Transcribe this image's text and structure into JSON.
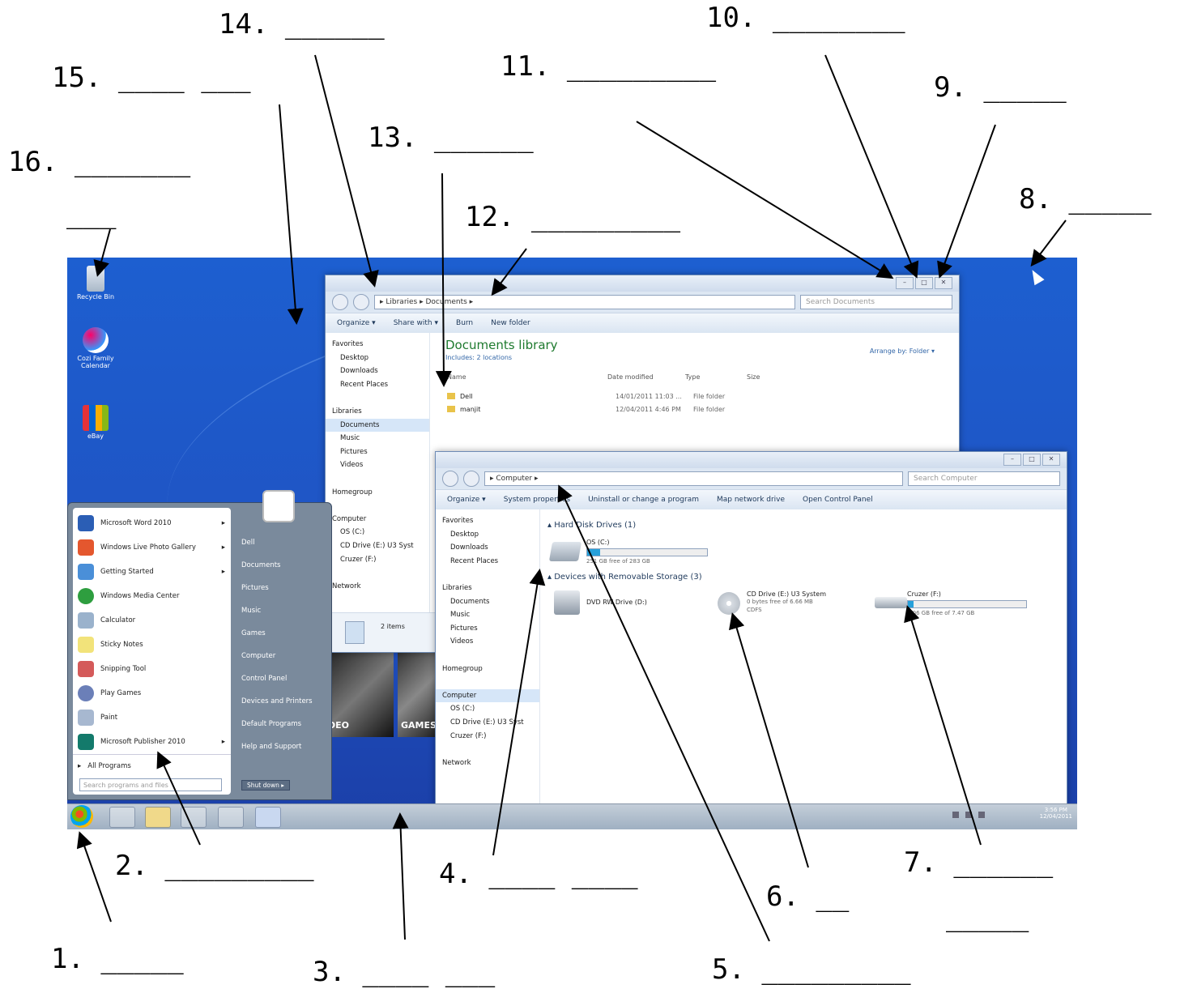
{
  "labels": {
    "l1": "1. _____",
    "l2": "2. _________",
    "l3": "3. ____ ___",
    "l4": "4. ____ ____",
    "l5": "5. _________",
    "l6": "6. __",
    "l7a": "7. ______",
    "l7b": "_____",
    "l8": "8. _____",
    "l9": "9. _____",
    "l10": "10. ________",
    "l11": "11. _________",
    "l12": "12. _________",
    "l13": "13. ______",
    "l14": "14. ______",
    "l15": "15. ____ ___",
    "l16a": "16. _______",
    "l16b": "___"
  },
  "desktop_icons": [
    "Recycle Bin",
    "Cozi Family Calendar",
    "eBay"
  ],
  "docs_window": {
    "address": "▸ Libraries ▸ Documents ▸",
    "search": "Search Documents",
    "toolbar": [
      "Organize ▾",
      "Share with ▾",
      "Burn",
      "New folder"
    ],
    "heading": "Documents library",
    "includes": "Includes: 2 locations",
    "arrange": "Arrange by:  Folder ▾",
    "columns": [
      "Name",
      "Date modified",
      "Type",
      "Size"
    ],
    "files": [
      {
        "name": "Dell",
        "date": "14/01/2011 11:03 ...",
        "type": "File folder"
      },
      {
        "name": "manjit",
        "date": "12/04/2011 4:46 PM",
        "type": "File folder"
      }
    ],
    "nav": [
      "Favorites",
      "Desktop",
      "Downloads",
      "Recent Places",
      "",
      "Libraries",
      "Documents",
      "Music",
      "Pictures",
      "Videos",
      "",
      "Homegroup",
      "",
      "Computer",
      "OS (C:)",
      "CD Drive (E:) U3 Syst",
      "Cruzer (F:)",
      "",
      "Network"
    ],
    "status": "2 items"
  },
  "comp_window": {
    "address": "▸ Computer ▸",
    "search": "Search Computer",
    "toolbar": [
      "Organize ▾",
      "System properties",
      "Uninstall or change a program",
      "Map network drive",
      "Open Control Panel"
    ],
    "hdd_heading": "▴ Hard Disk Drives (1)",
    "removable_heading": "▴ Devices with Removable Storage (3)",
    "os_name": "OS (C:)",
    "os_free": "251 GB free of 283 GB",
    "dvd": "DVD RW Drive (D:)",
    "cd_name": "CD Drive (E:) U3 System",
    "cd_free": "0 bytes free of 6.66 MB",
    "cd_fs": "CDFS",
    "cruzer_name": "Cruzer (F:)",
    "cruzer_free": "7.06 GB free of 7.47 GB",
    "os_used_fraction": 0.11,
    "cruzer_used_fraction": 0.05,
    "nav": [
      "Favorites",
      "Desktop",
      "Downloads",
      "Recent Places",
      "",
      "Libraries",
      "Documents",
      "Music",
      "Pictures",
      "Videos",
      "",
      "Homegroup",
      "",
      "Computer",
      "OS (C:)",
      "CD Drive (E:) U3 Syst",
      "Cruzer (F:)",
      "",
      "Network"
    ]
  },
  "start_menu": {
    "programs": [
      "Microsoft Word 2010",
      "Windows Live Photo Gallery",
      "Getting Started",
      "Windows Media Center",
      "Calculator",
      "Sticky Notes",
      "Snipping Tool",
      "Play Games",
      "Paint",
      "Microsoft Publisher 2010"
    ],
    "all_programs": "All Programs",
    "search": "Search programs and files",
    "right": [
      "Dell",
      "Documents",
      "Pictures",
      "Music",
      "Games",
      "Computer",
      "Control Panel",
      "Devices and Printers",
      "Default Programs",
      "Help and Support"
    ],
    "shutdown": "Shut down ▸",
    "tiles": [
      "DEO",
      "GAMES"
    ]
  },
  "taskbar": {
    "time": "3:56 PM",
    "date": "12/04/2011"
  }
}
